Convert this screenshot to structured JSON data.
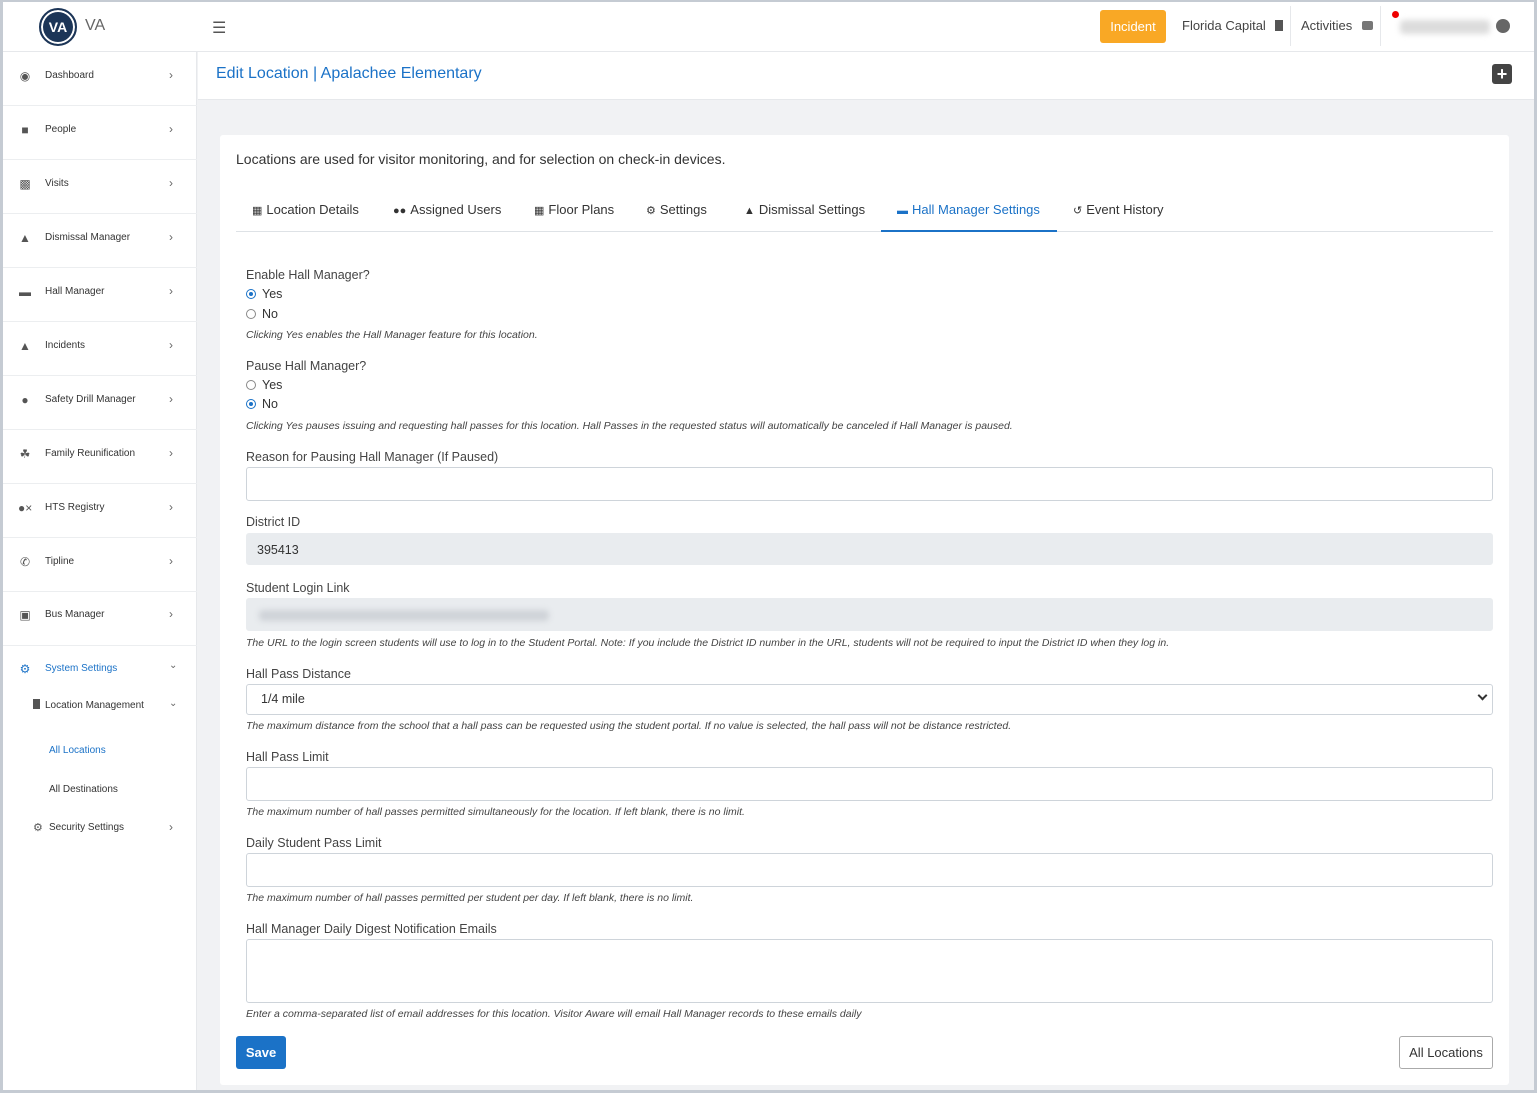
{
  "header": {
    "logo_text": "VA",
    "brand": "VA",
    "incident_label": "Incident",
    "location_label": "Florida Capital",
    "activities_label": "Activities"
  },
  "sidebar": {
    "items": [
      {
        "label": "Dashboard",
        "icon": "dashboard-icon"
      },
      {
        "label": "People",
        "icon": "id-badge-icon"
      },
      {
        "label": "Visits",
        "icon": "calendar-icon"
      },
      {
        "label": "Dismissal Manager",
        "icon": "car-icon"
      },
      {
        "label": "Hall Manager",
        "icon": "ticket-icon"
      },
      {
        "label": "Incidents",
        "icon": "warning-icon"
      },
      {
        "label": "Safety Drill Manager",
        "icon": "clock-icon"
      },
      {
        "label": "Family Reunification",
        "icon": "hand-icon"
      },
      {
        "label": "HTS Registry",
        "icon": "user-x-icon"
      },
      {
        "label": "Tipline",
        "icon": "phone-icon"
      },
      {
        "label": "Bus Manager",
        "icon": "bus-icon"
      }
    ],
    "system_settings": "System Settings",
    "location_management": "Location Management",
    "all_locations": "All Locations",
    "all_destinations": "All Destinations",
    "security_settings": "Security Settings"
  },
  "page": {
    "title": "Edit Location | Apalachee Elementary",
    "intro": "Locations are used for visitor monitoring, and for selection on check-in devices."
  },
  "tabs": [
    {
      "label": "Location Details",
      "icon": "map-icon"
    },
    {
      "label": "Assigned Users",
      "icon": "users-icon"
    },
    {
      "label": "Floor Plans",
      "icon": "table-icon"
    },
    {
      "label": "Settings",
      "icon": "gears-icon"
    },
    {
      "label": "Dismissal Settings",
      "icon": "car-icon"
    },
    {
      "label": "Hall Manager Settings",
      "icon": "ticket-icon",
      "active": true
    },
    {
      "label": "Event History",
      "icon": "history-icon"
    }
  ],
  "form": {
    "enable_label": "Enable Hall Manager?",
    "enable_yes": "Yes",
    "enable_no": "No",
    "enable_value": "Yes",
    "enable_help": "Clicking Yes enables the Hall Manager feature for this location.",
    "pause_label": "Pause Hall Manager?",
    "pause_yes": "Yes",
    "pause_no": "No",
    "pause_value": "No",
    "pause_help": "Clicking Yes pauses issuing and requesting hall passes for this location. Hall Passes in the requested status will automatically be canceled if Hall Manager is paused.",
    "reason_label": "Reason for Pausing Hall Manager (If Paused)",
    "reason_value": "",
    "district_label": "District ID",
    "district_value": "395413",
    "login_label": "Student Login Link",
    "login_help": "The URL to the login screen students will use to log in to the Student Portal. Note: If you include the District ID number in the URL, students will not be required to input the District ID when they log in.",
    "distance_label": "Hall Pass Distance",
    "distance_value": "1/4 mile",
    "distance_help": "The maximum distance from the school that a hall pass can be requested using the student portal. If no value is selected, the hall pass will not be distance restricted.",
    "limit_label": "Hall Pass Limit",
    "limit_value": "",
    "limit_help": "The maximum number of hall passes permitted simultaneously for the location. If left blank, there is no limit.",
    "daily_label": "Daily Student Pass Limit",
    "daily_value": "",
    "daily_help": "The maximum number of hall passes permitted per student per day. If left blank, there is no limit.",
    "digest_label": "Hall Manager Daily Digest Notification Emails",
    "digest_value": "",
    "digest_help": "Enter a comma-separated list of email addresses for this location. Visitor Aware will email Hall Manager records to these emails daily",
    "save_label": "Save",
    "all_locations_label": "All Locations"
  },
  "colors": {
    "accent": "#1b72c7",
    "incident": "#f9a825"
  }
}
